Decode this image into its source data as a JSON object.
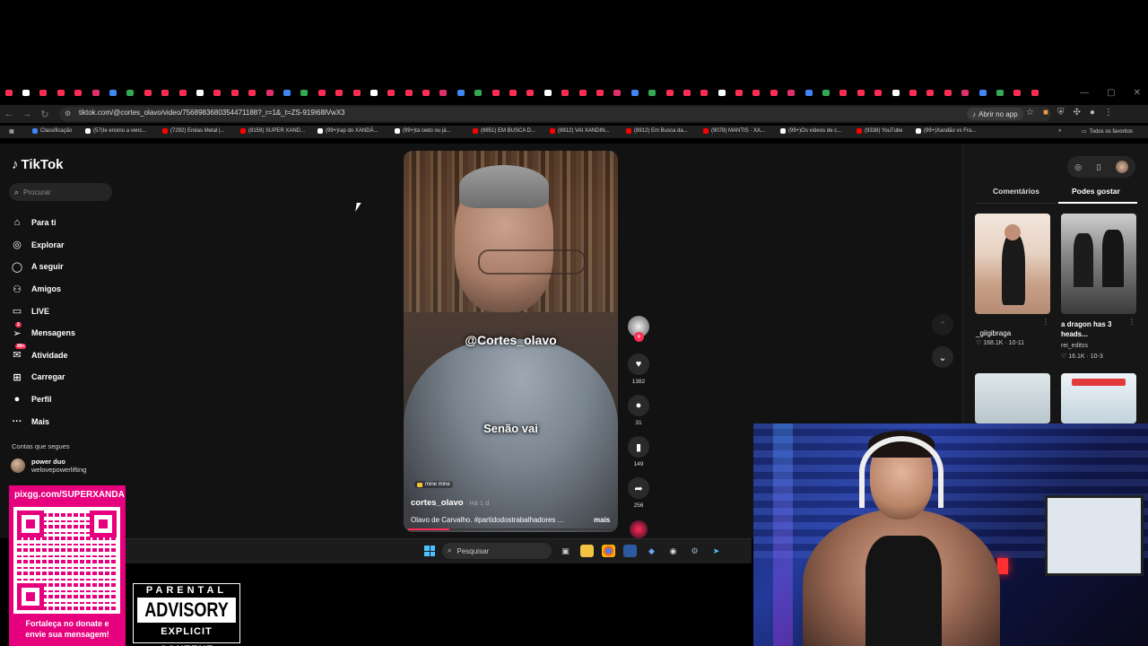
{
  "browser": {
    "url": "tiktok.com/@cortes_olavo/video/7568983680354471188?_r=1&_t=ZS-919I68lVwX3",
    "open_app_label": "Abrir no app",
    "all_bookmarks_label": "Todos os favoritos",
    "bookmarks": [
      {
        "label": "Classificação",
        "color": "#4285f4"
      },
      {
        "label": "(57)Ie ensino a venc...",
        "color": "#ffffff"
      },
      {
        "label": "(7292) Enéas Metal |...",
        "color": "#ff0000"
      },
      {
        "label": "(8159) SUPER XAND...",
        "color": "#ff0000"
      },
      {
        "label": "(99+)rap do XANDÃ...",
        "color": "#ffffff"
      },
      {
        "label": "(99+)tá cedo ou já...",
        "color": "#ffffff"
      },
      {
        "label": "(8851) EM BUSCA D...",
        "color": "#ff0000"
      },
      {
        "label": "(8912) VAI XANDIN...",
        "color": "#ff0000"
      },
      {
        "label": "(8912) Em Busca da...",
        "color": "#ff0000"
      },
      {
        "label": "(9078) MANTIS · XA...",
        "color": "#ff0000"
      },
      {
        "label": "(99+)Os vídeos de c...",
        "color": "#ffffff"
      },
      {
        "label": "(9338) YouTube",
        "color": "#ff0000"
      },
      {
        "label": "(99+)Xandão vs Fra...",
        "color": "#ffffff"
      }
    ]
  },
  "tiktok": {
    "logo_text": "TikTok",
    "search_placeholder": "Procurar",
    "nav": [
      {
        "label": "Para ti",
        "icon": "home-icon"
      },
      {
        "label": "Explorar",
        "icon": "compass-icon"
      },
      {
        "label": "A seguir",
        "icon": "following-icon"
      },
      {
        "label": "Amigos",
        "icon": "friends-icon"
      },
      {
        "label": "LIVE",
        "icon": "live-icon"
      },
      {
        "label": "Mensagens",
        "icon": "messages-icon",
        "badge": "2"
      },
      {
        "label": "Atividade",
        "icon": "activity-icon",
        "badge": "99+"
      },
      {
        "label": "Carregar",
        "icon": "upload-icon"
      },
      {
        "label": "Perfil",
        "icon": "profile-icon"
      },
      {
        "label": "Mais",
        "icon": "more-icon"
      }
    ],
    "following_heading": "Contas que segues",
    "following": [
      {
        "name": "power duo",
        "handle": "welovepowerlifting"
      }
    ],
    "video": {
      "overlay_handle": "@Cortes_olavo",
      "subtitle": "Senão vai",
      "music_tag": "mine mine",
      "author": "cortes_olavo",
      "ago": "· Há 1 d",
      "description": "Olavo de Carvalho. #partidodostrabalhadores ...",
      "more_label": "mais",
      "progress": 0.2
    },
    "actions": {
      "likes": "1382",
      "comments": "31",
      "saves": "149",
      "shares": "256"
    },
    "right_panel": {
      "tabs": [
        "Comentários",
        "Podes gostar"
      ],
      "active_tab": "Podes gostar",
      "items": [
        {
          "title": "",
          "user": "_giigibraga",
          "likes": "168.1K",
          "date": "10-11"
        },
        {
          "title": "a dragon has 3 heads...",
          "user": "rei_editss",
          "likes": "16.1K",
          "date": "10-3"
        }
      ]
    }
  },
  "taskbar": {
    "search_placeholder": "Pesquisar"
  },
  "overlays": {
    "donate_url": "pixgg.com/SUPERXANDA",
    "donate_footer_1": "Fortaleça no donate e",
    "donate_footer_2": "envie sua mensagem!",
    "advisory_top": "PARENTAL",
    "advisory_mid": "ADVISORY",
    "advisory_bot": "EXPLICIT CONTENT"
  },
  "colors": {
    "accent": "#fe2c55",
    "donate_bg": "#e6007e"
  }
}
